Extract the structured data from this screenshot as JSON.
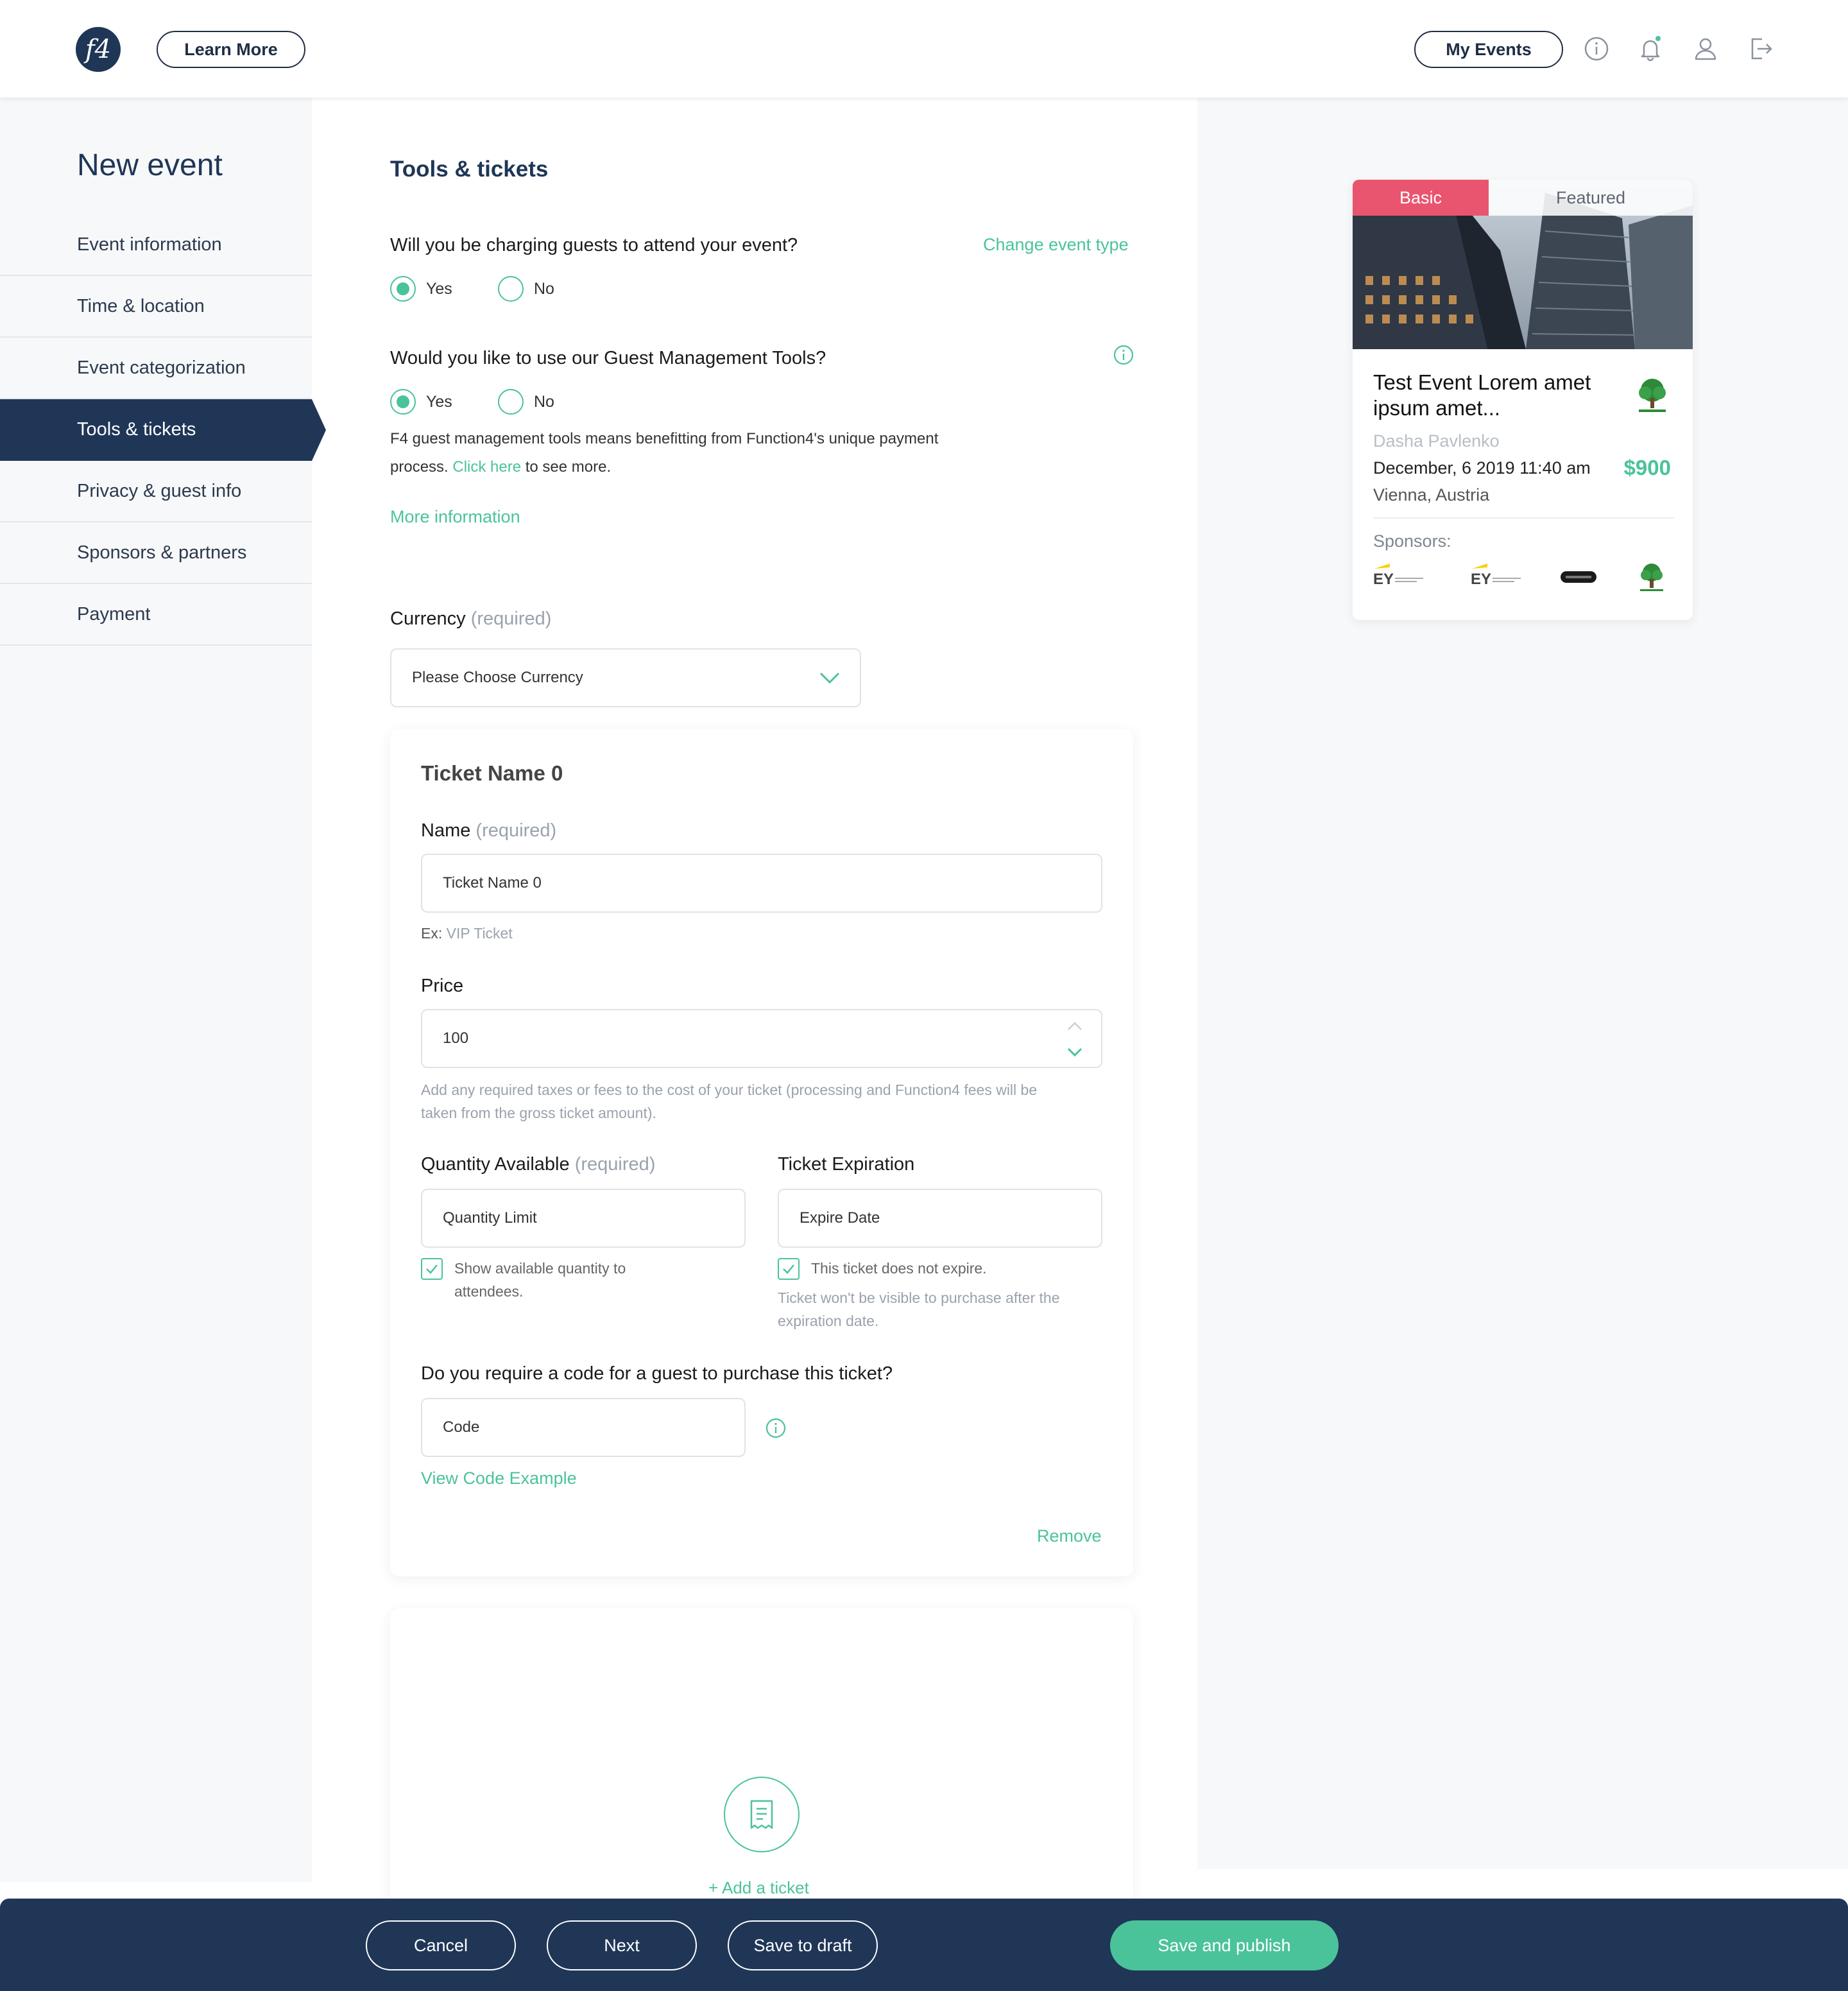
{
  "header": {
    "logo_text": "f4",
    "learn_more": "Learn More",
    "my_events": "My Events"
  },
  "sidebar": {
    "title": "New event",
    "items": [
      {
        "label": "Event information"
      },
      {
        "label": "Time & location"
      },
      {
        "label": "Event categorization"
      },
      {
        "label": "Tools & tickets",
        "active": true
      },
      {
        "label": "Privacy & guest info"
      },
      {
        "label": "Sponsors & partners"
      },
      {
        "label": "Payment"
      }
    ]
  },
  "main": {
    "section_title": "Tools & tickets",
    "charge_question": "Will you be charging guests to attend your event?",
    "change_event_type": "Change event type",
    "charge_yes": "Yes",
    "charge_no": "No",
    "charge_selected": "Yes",
    "gmt_question": "Would you like to use our Guest Management Tools?",
    "gmt_yes": "Yes",
    "gmt_no": "No",
    "gmt_selected": "Yes",
    "gmt_desc_1": "F4 guest management tools means benefitting from Function4's unique payment",
    "gmt_desc_2_pre": "process.",
    "gmt_desc_link": "Click here",
    "gmt_desc_2_post": "to see more.",
    "more_info": "More information",
    "currency_label": "Currency",
    "required": "(required)",
    "currency_placeholder": "Please Choose Currency"
  },
  "ticket": {
    "title": "Ticket Name 0",
    "name_label": "Name",
    "name_required": "(required)",
    "name_value": "Ticket Name 0",
    "name_hint_prefix": "Ex:",
    "name_hint": "VIP Ticket",
    "price_label": "Price",
    "price_value": "100",
    "price_hint_1": "Add any required taxes or fees to the cost of your ticket (processing and Function4 fees will be",
    "price_hint_2": "taken from the gross ticket amount).",
    "quantity_label": "Quantity Available",
    "quantity_required": "(required)",
    "quantity_placeholder": "Quantity Limit",
    "show_quantity_1": "Show available quantity to",
    "show_quantity_2": "attendees.",
    "show_quantity_checked": true,
    "expiration_label": "Ticket Expiration",
    "expire_placeholder": "Expire Date",
    "no_expire": "This ticket does not expire.",
    "no_expire_checked": true,
    "expire_hint_1": "Ticket won't be visible to purchase after the",
    "expire_hint_2": "expiration date.",
    "code_question": "Do you require a code for a guest to purchase this ticket?",
    "code_placeholder": "Code",
    "view_code_example": "View Code Example",
    "remove": "Remove"
  },
  "add_ticket": "+ Add a ticket",
  "preview": {
    "tab_basic": "Basic",
    "tab_featured": "Featured",
    "title_1": "Test Event Lorem amet",
    "title_2": "ipsum amet...",
    "organizer": "Dasha Pavlenko",
    "datetime": "December, 6 2019 11:40 am",
    "location": "Vienna, Austria",
    "price": "$900",
    "sponsors_label": "Sponsors:",
    "sponsor_logos": [
      "EY",
      "EY",
      "DARK-BADGE",
      "TREE-COMPANY"
    ]
  },
  "footer": {
    "cancel": "Cancel",
    "next": "Next",
    "save_draft": "Save to draft",
    "save_publish": "Save and publish"
  },
  "colors": {
    "navy": "#1f3657",
    "accent_green": "#4bc39a",
    "basic_tab": "#e9556e"
  }
}
